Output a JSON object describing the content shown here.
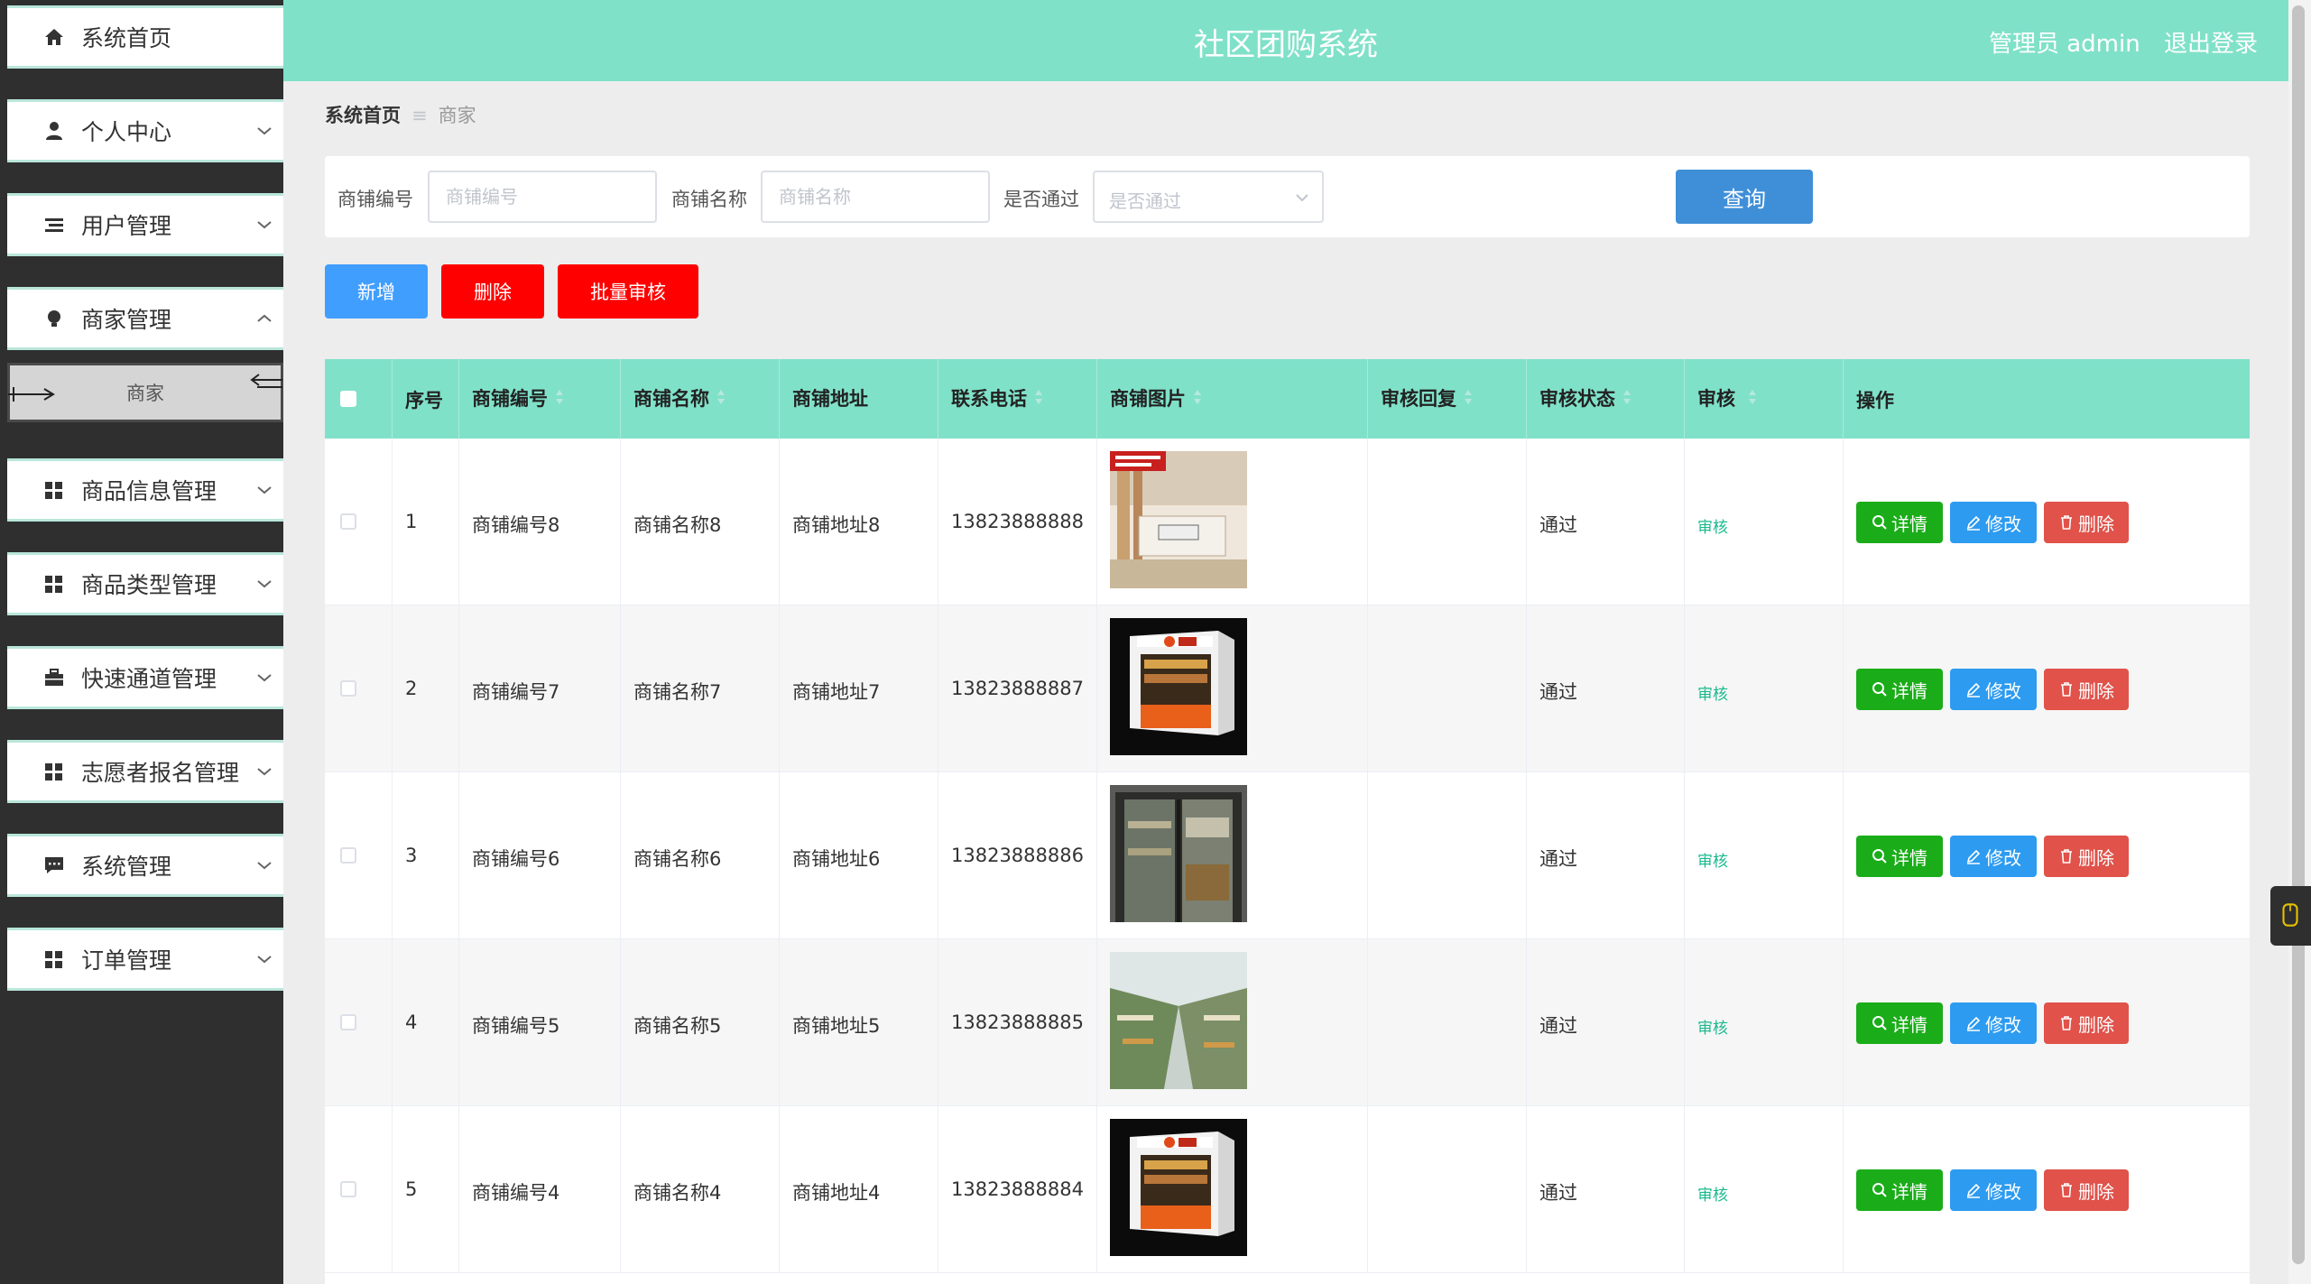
{
  "app": {
    "title": "社区团购系统",
    "user_label": "管理员 admin",
    "logout_label": "退出登录"
  },
  "sidebar": {
    "items": [
      {
        "label": "系统首页",
        "icon": "home-icon"
      },
      {
        "label": "个人中心",
        "icon": "person-icon"
      },
      {
        "label": "用户管理",
        "icon": "list-icon"
      },
      {
        "label": "商家管理",
        "icon": "bulb-icon",
        "expanded": true
      },
      {
        "label": "商品信息管理",
        "icon": "grid-icon"
      },
      {
        "label": "商品类型管理",
        "icon": "grid-icon"
      },
      {
        "label": "快速通道管理",
        "icon": "briefcase-icon"
      },
      {
        "label": "志愿者报名管理",
        "icon": "grid-icon"
      },
      {
        "label": "系统管理",
        "icon": "chat-icon"
      },
      {
        "label": "订单管理",
        "icon": "grid-icon"
      }
    ],
    "submenu": {
      "label": "商家"
    }
  },
  "breadcrumb": {
    "home": "系统首页",
    "separator": "≡",
    "current": "商家"
  },
  "search": {
    "shop_no_label": "商铺编号",
    "shop_no_placeholder": "商铺编号",
    "shop_no_value": "",
    "shop_name_label": "商铺名称",
    "shop_name_placeholder": "商铺名称",
    "shop_name_value": "",
    "passed_label": "是否通过",
    "passed_placeholder": "是否通过",
    "query_label": "查询"
  },
  "actions": {
    "add_label": "新增",
    "delete_label": "删除",
    "batch_audit_label": "批量审核"
  },
  "table": {
    "headers": {
      "index": "序号",
      "shop_no": "商铺编号",
      "shop_name": "商铺名称",
      "address": "商铺地址",
      "phone": "联系电话",
      "image": "商铺图片",
      "reply": "审核回复",
      "status": "审核状态",
      "audit": "审核",
      "ops": "操作"
    },
    "rows": [
      {
        "index": "1",
        "shop_no": "商铺编号8",
        "shop_name": "商铺名称8",
        "address": "商铺地址8",
        "phone": "13823888888",
        "reply": "",
        "status": "通过",
        "audit": "审核",
        "image": "store-counter"
      },
      {
        "index": "2",
        "shop_no": "商铺编号7",
        "shop_name": "商铺名称7",
        "address": "商铺地址7",
        "phone": "13823888887",
        "reply": "",
        "status": "通过",
        "audit": "审核",
        "image": "store-kiosk"
      },
      {
        "index": "3",
        "shop_no": "商铺编号6",
        "shop_name": "商铺名称6",
        "address": "商铺地址6",
        "phone": "13823888886",
        "reply": "",
        "status": "通过",
        "audit": "审核",
        "image": "store-door"
      },
      {
        "index": "4",
        "shop_no": "商铺编号5",
        "shop_name": "商铺名称5",
        "address": "商铺地址5",
        "phone": "13823888885",
        "reply": "",
        "status": "通过",
        "audit": "审核",
        "image": "store-mall"
      },
      {
        "index": "5",
        "shop_no": "商铺编号4",
        "shop_name": "商铺名称4",
        "address": "商铺地址4",
        "phone": "13823888884",
        "reply": "",
        "status": "通过",
        "audit": "审核",
        "image": "store-kiosk"
      }
    ],
    "row_buttons": {
      "detail": "详情",
      "edit": "修改",
      "delete": "删除"
    }
  },
  "colors": {
    "accent": "#80e1c9",
    "sidebar_bg": "#2f2f2f",
    "query_button": "#3f8fd8",
    "add_button": "#409eff",
    "danger_button": "#ff0000",
    "detail_button": "#1aad19",
    "edit_button": "#2d9bf0",
    "row_delete_button": "#e0524a",
    "audit_link": "#19b98c"
  }
}
